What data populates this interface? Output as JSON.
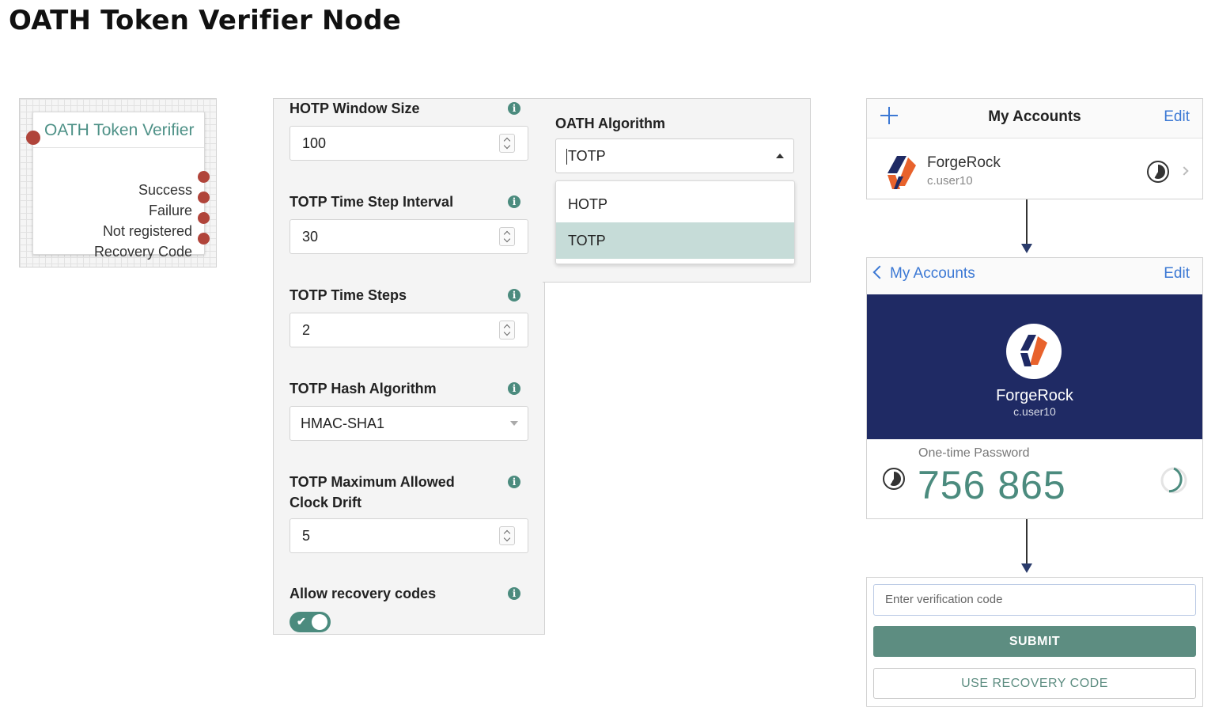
{
  "page_title": "OATH Token Verifier Node",
  "node": {
    "title": "OATH Token Verifier",
    "outcomes": [
      "Success",
      "Failure",
      "Not registered",
      "Recovery Code"
    ]
  },
  "config": {
    "hotp_window_size": {
      "label": "HOTP Window Size",
      "value": "100"
    },
    "totp_time_step_interval": {
      "label": "TOTP Time Step Interval",
      "value": "30"
    },
    "totp_time_steps": {
      "label": "TOTP Time Steps",
      "value": "2"
    },
    "totp_hash_algorithm": {
      "label": "TOTP Hash Algorithm",
      "value": "HMAC-SHA1"
    },
    "totp_max_clock_drift": {
      "label_line1": "TOTP Maximum Allowed",
      "label_line2": "Clock Drift",
      "value": "5"
    },
    "allow_recovery_codes": {
      "label": "Allow recovery codes",
      "enabled": true
    },
    "info_glyph": "i"
  },
  "oath_algorithm": {
    "label": "OATH Algorithm",
    "value": "TOTP",
    "options": [
      "HOTP",
      "TOTP"
    ],
    "selected": "TOTP"
  },
  "phone_accounts": {
    "title": "My Accounts",
    "edit_label": "Edit",
    "account_name": "ForgeRock",
    "account_user": "c.user10"
  },
  "phone_detail": {
    "back_label": "My Accounts",
    "edit_label": "Edit",
    "account_name": "ForgeRock",
    "account_user": "c.user10",
    "otp_label": "One-time Password",
    "otp_value": "756 865"
  },
  "verify": {
    "placeholder": "Enter verification code",
    "submit_label": "SUBMIT",
    "recovery_label": "USE RECOVERY CODE"
  },
  "colors": {
    "accent_teal": "#4b8b7e",
    "outcome_dot": "#b0443a",
    "link_blue": "#3b78d4",
    "banner_navy": "#1f2a64",
    "logo_orange": "#e8622c"
  },
  "icons": [
    "plus-icon",
    "back-chevron-icon",
    "clock-icon",
    "chevron-right-icon",
    "info-icon",
    "forgerock-logo",
    "caret-icon",
    "spinner-icon"
  ]
}
